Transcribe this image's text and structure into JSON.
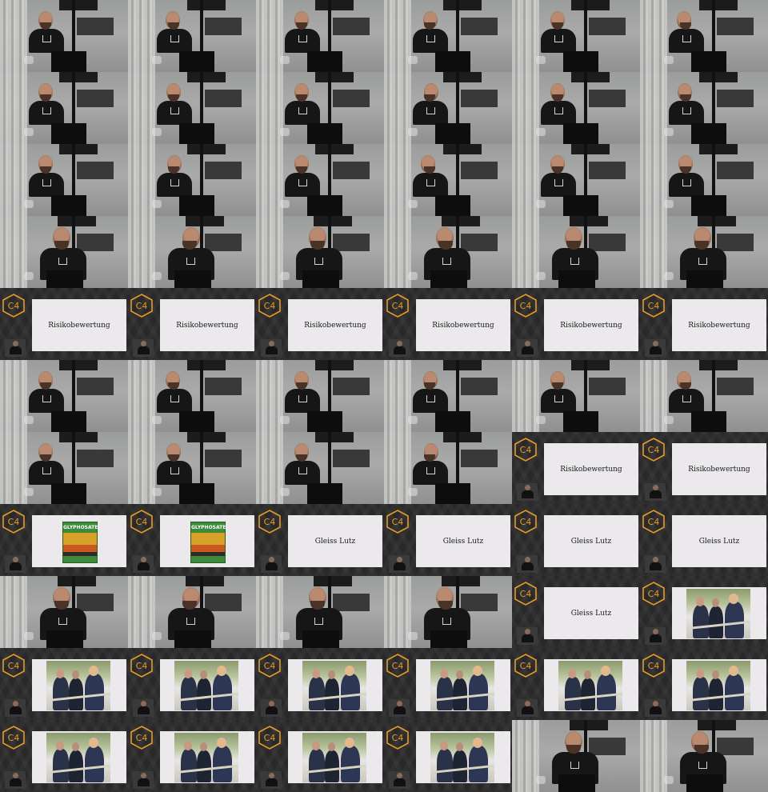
{
  "contact_sheet": {
    "columns": 6,
    "rows": 11,
    "brand_mark": "C4",
    "accent_color": "#e79a2a",
    "frames": [
      "cam",
      "cam",
      "cam",
      "cam",
      "cam",
      "cam",
      "cam",
      "cam",
      "cam",
      "cam",
      "cam",
      "cam",
      "cam",
      "cam",
      "cam",
      "cam",
      "cam",
      "cam",
      "cam-close",
      "cam-close",
      "cam-close",
      "cam-close",
      "cam-close",
      "cam-close",
      "slide-text-1",
      "slide-text-1",
      "slide-text-1",
      "slide-text-1",
      "slide-text-1",
      "slide-text-1",
      "cam",
      "cam",
      "cam",
      "cam",
      "cam",
      "cam",
      "cam",
      "cam",
      "cam",
      "cam",
      "slide-text-1",
      "slide-text-1",
      "slide-sign",
      "slide-sign",
      "slide-text-2",
      "slide-text-2",
      "slide-text-2",
      "slide-text-2",
      "cam-close",
      "cam-close",
      "cam-close",
      "cam-close",
      "slide-text-2",
      "slide-photo",
      "slide-photo",
      "slide-photo",
      "slide-photo",
      "slide-photo",
      "slide-photo",
      "slide-photo",
      "slide-photo",
      "slide-photo",
      "slide-photo",
      "slide-photo",
      "cam-close",
      "cam-close"
    ],
    "slide_titles": {
      "slide-text-1": "Risikobewertung",
      "slide-text-2": "Gleiss Lutz"
    },
    "sign_text": "GLYPHOSATE"
  }
}
